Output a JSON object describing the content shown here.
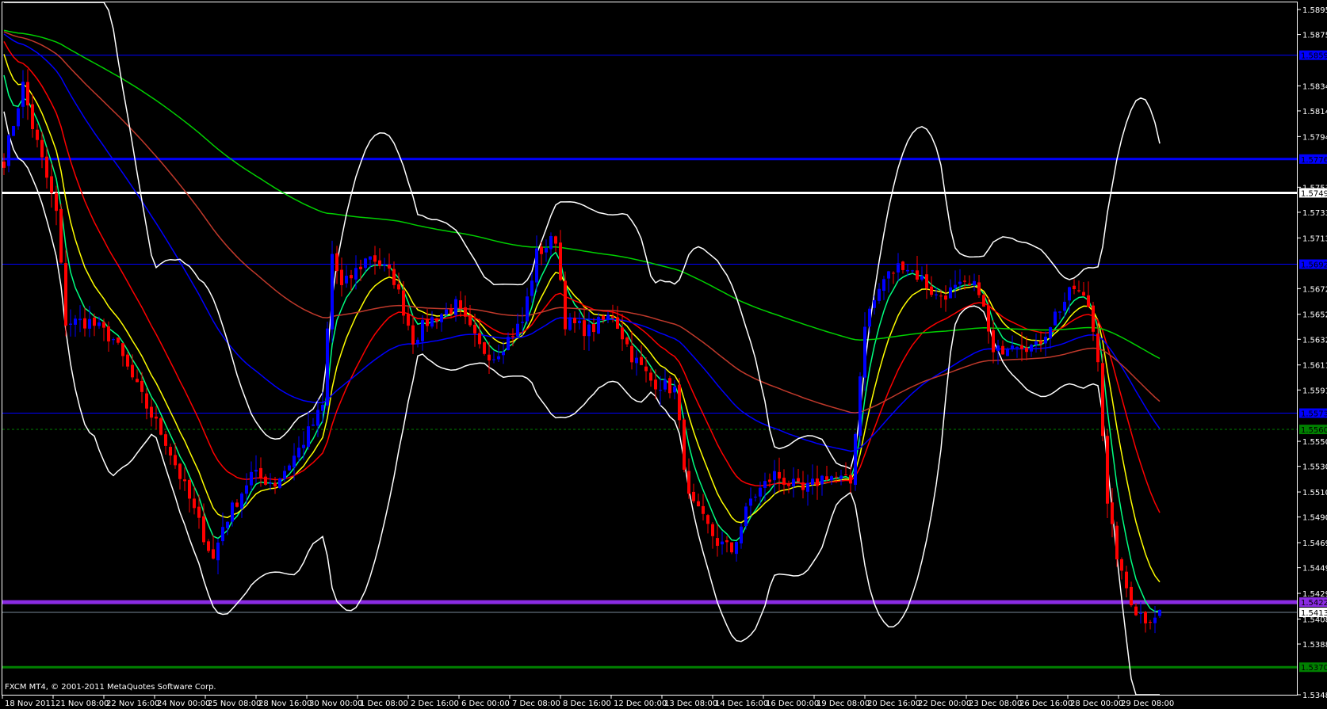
{
  "chart_data": {
    "type": "candlestick",
    "symbol_footer": "FXCM MT4, © 2001-2011 MetaQuotes Software Corp.",
    "ylim": [
      1.5348,
      1.58955
    ],
    "colors": {
      "up": "#0000ff",
      "down": "#ff0000",
      "background": "#000000",
      "axis": "#ffffff"
    },
    "bar_count": 244,
    "warmup_price": 1.588,
    "close_keypoints": [
      [
        0,
        1.5775
      ],
      [
        4,
        1.5835
      ],
      [
        6,
        1.5802
      ],
      [
        11,
        1.5733
      ],
      [
        13,
        1.5646
      ],
      [
        18,
        1.5646
      ],
      [
        23,
        1.5632
      ],
      [
        29,
        1.5585
      ],
      [
        34,
        1.5551
      ],
      [
        39,
        1.5504
      ],
      [
        44,
        1.5456
      ],
      [
        46,
        1.5483
      ],
      [
        52,
        1.5524
      ],
      [
        57,
        1.5517
      ],
      [
        62,
        1.5544
      ],
      [
        67,
        1.5578
      ],
      [
        69,
        1.57
      ],
      [
        71,
        1.5673
      ],
      [
        77,
        1.57
      ],
      [
        82,
        1.568
      ],
      [
        86,
        1.5632
      ],
      [
        89,
        1.5646
      ],
      [
        95,
        1.5659
      ],
      [
        100,
        1.5625
      ],
      [
        103,
        1.5619
      ],
      [
        109,
        1.5646
      ],
      [
        112,
        1.57
      ],
      [
        116,
        1.5713
      ],
      [
        118,
        1.5646
      ],
      [
        123,
        1.5639
      ],
      [
        128,
        1.5652
      ],
      [
        132,
        1.5619
      ],
      [
        136,
        1.5599
      ],
      [
        141,
        1.5592
      ],
      [
        144,
        1.5504
      ],
      [
        150,
        1.547
      ],
      [
        153,
        1.5463
      ],
      [
        157,
        1.5504
      ],
      [
        162,
        1.5524
      ],
      [
        168,
        1.551
      ],
      [
        173,
        1.5524
      ],
      [
        178,
        1.5517
      ],
      [
        181,
        1.5646
      ],
      [
        185,
        1.568
      ],
      [
        189,
        1.5693
      ],
      [
        193,
        1.568
      ],
      [
        196,
        1.5666
      ],
      [
        201,
        1.5673
      ],
      [
        205,
        1.5673
      ],
      [
        208,
        1.5619
      ],
      [
        212,
        1.5632
      ],
      [
        217,
        1.5625
      ],
      [
        221,
        1.5652
      ],
      [
        225,
        1.5673
      ],
      [
        228,
        1.5659
      ],
      [
        230,
        1.5619
      ],
      [
        232,
        1.5497
      ],
      [
        235,
        1.5442
      ],
      [
        238,
        1.5415
      ],
      [
        240,
        1.5409
      ],
      [
        243,
        1.5414
      ]
    ],
    "indicators": [
      {
        "name": "EMA 5",
        "period": 5,
        "color": "#00ff80"
      },
      {
        "name": "EMA 10",
        "period": 10,
        "color": "#ffff00"
      },
      {
        "name": "EMA 21",
        "period": 21,
        "color": "#ff0000"
      },
      {
        "name": "EMA 55",
        "period": 55,
        "color": "#0000ff"
      },
      {
        "name": "EMA 100",
        "period": 100,
        "color": "#c0392b"
      },
      {
        "name": "EMA 200",
        "period": 200,
        "color": "#00d000"
      },
      {
        "name": "Bollinger Bands",
        "period": 20,
        "deviation": 2.5,
        "color": "#ffffff"
      }
    ],
    "levels": [
      {
        "price": 1.5859,
        "label": "1.58590",
        "color": "#0000ff",
        "style": "thin"
      },
      {
        "price": 1.5776,
        "label": "1.57760",
        "color": "#0000ff",
        "style": "thick"
      },
      {
        "price": 1.5749,
        "label": "1.57490",
        "color": "#ffffff",
        "style": "thick"
      },
      {
        "price": 1.5692,
        "label": "1.56920",
        "color": "#0000ff",
        "style": "thin"
      },
      {
        "price": 1.5573,
        "label": "1.55730",
        "color": "#0000ff",
        "style": "thin"
      },
      {
        "price": 1.556,
        "label": "1.55600",
        "color": "#008000",
        "style": "dashed"
      },
      {
        "price": 1.5422,
        "label": "1.54220",
        "color": "#8a2be2",
        "style": "heavy"
      },
      {
        "price": 1.54138,
        "label": "1.54138",
        "color": "#778899",
        "style": "bid"
      },
      {
        "price": 1.537,
        "label": "1.53700",
        "color": "#008000",
        "style": "thick"
      }
    ],
    "y_ticks": [
      "1.58955",
      "1.58755",
      "1.58345",
      "1.58145",
      "1.57940",
      "1.57535",
      "1.57335",
      "1.57130",
      "1.56725",
      "1.56520",
      "1.56320",
      "1.56115",
      "1.55915",
      "1.55505",
      "1.55305",
      "1.55100",
      "1.54900",
      "1.54695",
      "1.54495",
      "1.54290",
      "1.54085",
      "1.53885",
      "1.53480"
    ],
    "x_ticks": [
      "18 Nov 2011",
      "21 Nov 08:00",
      "22 Nov 16:00",
      "24 Nov 00:00",
      "25 Nov 08:00",
      "28 Nov 16:00",
      "30 Nov 00:00",
      "1 Dec 08:00",
      "2 Dec 16:00",
      "6 Dec 00:00",
      "7 Dec 08:00",
      "8 Dec 16:00",
      "12 Dec 00:00",
      "13 Dec 08:00",
      "14 Dec 16:00",
      "16 Dec 00:00",
      "19 Dec 08:00",
      "20 Dec 16:00",
      "22 Dec 00:00",
      "23 Dec 08:00",
      "26 Dec 16:00",
      "28 Dec 00:00",
      "29 Dec 08:00"
    ]
  }
}
